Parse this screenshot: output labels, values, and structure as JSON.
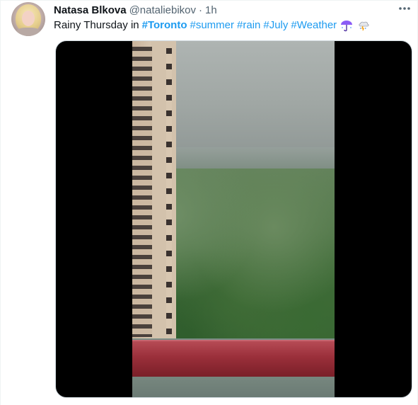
{
  "tweet": {
    "display_name": "Natasa Blkova",
    "handle": "@nataliebikov",
    "separator": "·",
    "timestamp": "1h",
    "text_prefix": "Rainy Thursday in",
    "hashtags": [
      {
        "text": "#Toronto",
        "bold": true
      },
      {
        "text": "#summer",
        "bold": false
      },
      {
        "text": "#rain",
        "bold": false
      },
      {
        "text": "#July",
        "bold": false
      },
      {
        "text": "#Weather",
        "bold": false
      }
    ],
    "emojis": [
      "umbrella-with-rain-icon",
      "cloud-with-rain-icon"
    ],
    "more_icon": "more-horizontal-icon"
  },
  "colors": {
    "text": "#0f1419",
    "muted": "#536471",
    "link": "#1d9bf0",
    "border": "#cfd9de"
  }
}
